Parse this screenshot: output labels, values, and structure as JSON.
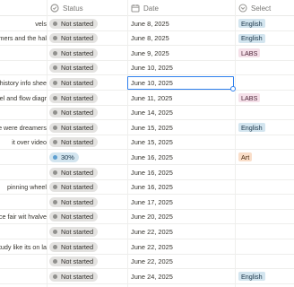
{
  "headers": {
    "status": "Status",
    "date": "Date",
    "select": "Select",
    "status_icon": "status-circle-icon",
    "date_icon": "calendar-icon",
    "select_icon": "select-chevron-icon"
  },
  "status_styles": {
    "Not started": {
      "bg": "#e3e2e0",
      "dot": "#91918e",
      "text": "#32302c"
    },
    "30%": {
      "bg": "#d3e5ef",
      "dot": "#5e9fd0",
      "text": "#183347"
    }
  },
  "tag_styles": {
    "English": {
      "bg": "#d3e5ef",
      "text": "#183347"
    },
    "LABS": {
      "bg": "#f5e0e9",
      "text": "#4c2337"
    },
    "Art": {
      "bg": "#fadec9",
      "text": "#49290e"
    }
  },
  "rows": [
    {
      "name": "vels",
      "status": "Not started",
      "date": "June 8, 2025",
      "tag": "English"
    },
    {
      "name": "rmers and the hal",
      "status": "Not started",
      "date": "June 8, 2025",
      "tag": "English"
    },
    {
      "name": "",
      "status": "Not started",
      "date": "June 9, 2025",
      "tag": "LABS"
    },
    {
      "name": "",
      "status": "Not started",
      "date": "June 10, 2025",
      "tag": ""
    },
    {
      "name": "r history info shee",
      "status": "Not started",
      "date": "June 10, 2025",
      "tag": ""
    },
    {
      "name": "eel and flow diagr",
      "status": "Not started",
      "date": "June 11, 2025",
      "tag": "LABS"
    },
    {
      "name": "",
      "status": "Not started",
      "date": "June 14, 2025",
      "tag": ""
    },
    {
      "name": "re were dreamers",
      "status": "Not started",
      "date": "June 15, 2025",
      "tag": "English"
    },
    {
      "name": "it over video",
      "status": "Not started",
      "date": "June 15, 2025",
      "tag": ""
    },
    {
      "name": "",
      "status": "30%",
      "date": "June 16, 2025",
      "tag": "Art"
    },
    {
      "name": "",
      "status": "Not started",
      "date": "June 16, 2025",
      "tag": ""
    },
    {
      "name": "pinning wheel",
      "status": "Not started",
      "date": "June 16, 2025",
      "tag": ""
    },
    {
      "name": "",
      "status": "Not started",
      "date": "June 17, 2025",
      "tag": ""
    },
    {
      "name": "ce fair wit hvalve",
      "status": "Not started",
      "date": "June 20, 2025",
      "tag": ""
    },
    {
      "name": "",
      "status": "Not started",
      "date": "June 22, 2025",
      "tag": ""
    },
    {
      "name": "study like its on la",
      "status": "Not started",
      "date": "June 22, 2025",
      "tag": ""
    },
    {
      "name": "",
      "status": "Not started",
      "date": "June 22, 2025",
      "tag": ""
    },
    {
      "name": "",
      "status": "Not started",
      "date": "June 24, 2025",
      "tag": "English"
    }
  ],
  "selected_row": 4
}
